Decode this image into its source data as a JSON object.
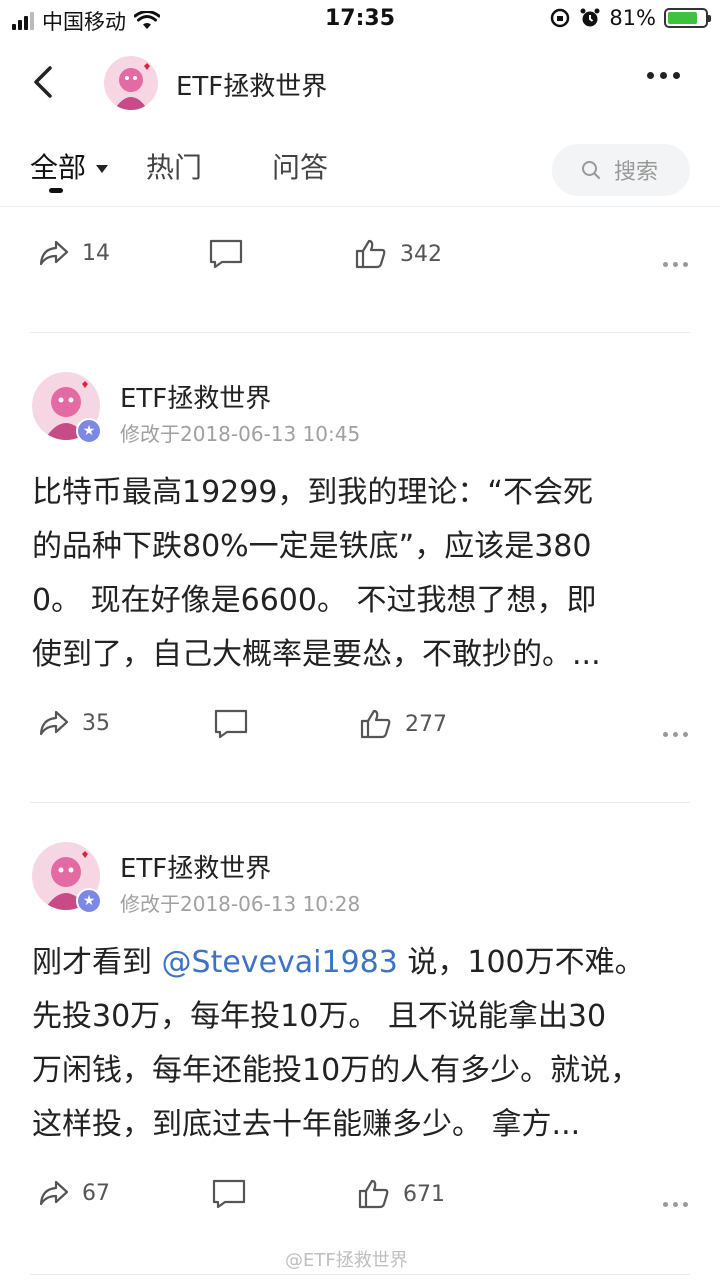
{
  "status": {
    "carrier": "中国移动",
    "time": "17:35",
    "battery": "81%",
    "battery_level": 0.81
  },
  "nav": {
    "title": "ETF拯救世界"
  },
  "tabs": {
    "all": "全部",
    "hot": "热门",
    "qa": "问答",
    "search_placeholder": "搜索"
  },
  "top_actions": {
    "shares": "14",
    "likes": "342"
  },
  "posts": [
    {
      "author": "ETF拯救世界",
      "time": "修改于2018-06-13 10:45",
      "lines": [
        "比特币最高19299，到我的理论：“不会死",
        "的品种下跌80%一定是铁底”，应该是380",
        "0。 现在好像是6600。 不过我想了想，即",
        "使到了，自己大概率是要怂，不敢抄的。..."
      ],
      "shares": "35",
      "likes": "277"
    },
    {
      "author": "ETF拯救世界",
      "time": "修改于2018-06-13 10:28",
      "line1_pre": "刚才看到 ",
      "mention": "@Stevevai1983",
      "line1_post": " 说，100万不难。",
      "lines": [
        "先投30万，每年投10万。 且不说能拿出30",
        "万闲钱，每年还能投10万的人有多少。就说，",
        "这样投，到底过去十年能赚多少。 拿方..."
      ],
      "shares": "67",
      "likes": "671"
    }
  ],
  "watermark": "@ETF拯救世界",
  "colors": {
    "mention": "#3d73c7",
    "verified": "#7b88e6",
    "battery": "#3ec13e"
  }
}
